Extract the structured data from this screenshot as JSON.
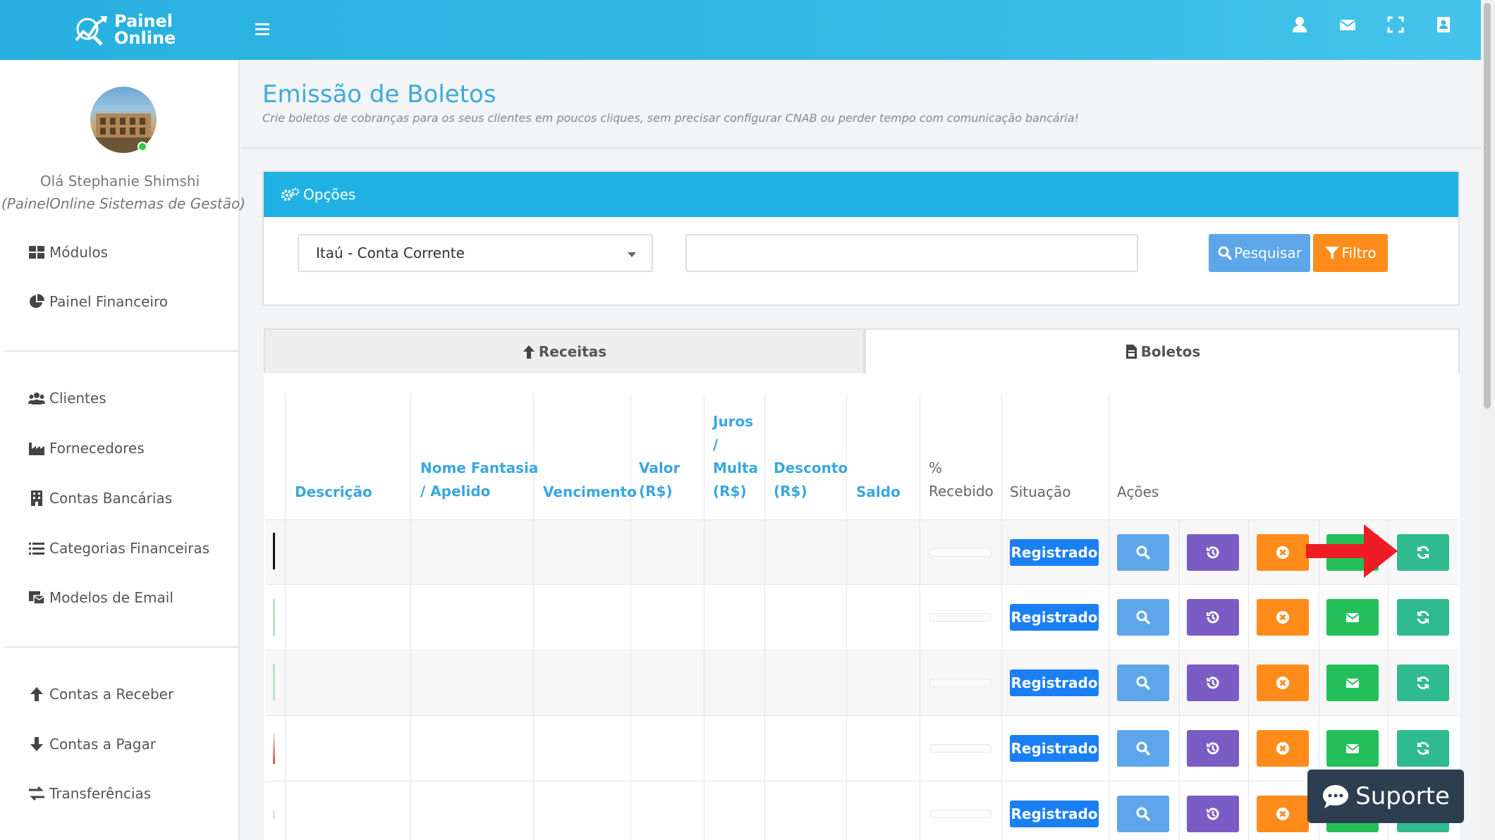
{
  "brand": {
    "line1": "Painel",
    "line2": "Online"
  },
  "colors": {
    "topbar": "#27b0df",
    "accent": "#3ea9dc",
    "panel_head": "#1fb1e3",
    "badge": "#1b7ff4",
    "view": "#5ea6ea",
    "history": "#7b5cc4",
    "cancel": "#ff8c1a",
    "email": "#23c05a",
    "refresh": "#2fbb8f",
    "filter": "#ff8c1a",
    "search": "#5ea6ea"
  },
  "user": {
    "greeting": "Olá Stephanie Shimshi",
    "company": "(PainelOnline Sistemas de Gestão)"
  },
  "sidebar": {
    "items": [
      {
        "label": "Módulos",
        "icon": "grid-icon"
      },
      {
        "label": "Painel Financeiro",
        "icon": "pie-chart-icon"
      },
      {
        "label": "Clientes",
        "icon": "users-icon"
      },
      {
        "label": "Fornecedores",
        "icon": "industry-icon"
      },
      {
        "label": "Contas Bancárias",
        "icon": "building-icon"
      },
      {
        "label": "Categorias Financeiras",
        "icon": "list-icon"
      },
      {
        "label": "Modelos de Email",
        "icon": "email-template-icon"
      },
      {
        "label": "Contas a Receber",
        "icon": "arrow-up-icon"
      },
      {
        "label": "Contas a Pagar",
        "icon": "arrow-down-icon"
      },
      {
        "label": "Transferências",
        "icon": "exchange-icon"
      }
    ]
  },
  "page": {
    "title": "Emissão de Boletos",
    "subtitle": "Crie boletos de cobranças para os seus clientes em poucos cliques, sem precisar configurar CNAB ou perder tempo com comunicação bancária!"
  },
  "options": {
    "title": "Opções",
    "account_select": "Itaú - Conta Corrente",
    "search_value": "",
    "search_button": "Pesquisar",
    "filter_button": "Filtro"
  },
  "tabs": {
    "receitas": "Receitas",
    "boletos": "Boletos"
  },
  "table": {
    "headers": {
      "descricao": "Descrição",
      "nome_l1": "Nome Fantasia",
      "nome_l2": "/ Apelido",
      "vencimento": "Vencimento",
      "valor_l1": "Valor",
      "valor_l2": "(R$)",
      "juros_l1": "Juros",
      "juros_l2": "/",
      "juros_l3": "Multa",
      "juros_l4": "(R$)",
      "desconto_l1": "Desconto",
      "desconto_l2": "(R$)",
      "saldo": "Saldo",
      "recebido_l1": "%",
      "recebido_l2": "Recebido",
      "situacao": "Situação",
      "acoes": "Ações"
    },
    "rows": [
      {
        "situacao": "Registrado",
        "recebido_pct": 0
      },
      {
        "situacao": "Registrado",
        "recebido_pct": 0
      },
      {
        "situacao": "Registrado",
        "recebido_pct": 0
      },
      {
        "situacao": "Registrado",
        "recebido_pct": 0
      },
      {
        "situacao": "Registrado",
        "recebido_pct": 0
      }
    ]
  },
  "support": {
    "label": "Suporte"
  }
}
